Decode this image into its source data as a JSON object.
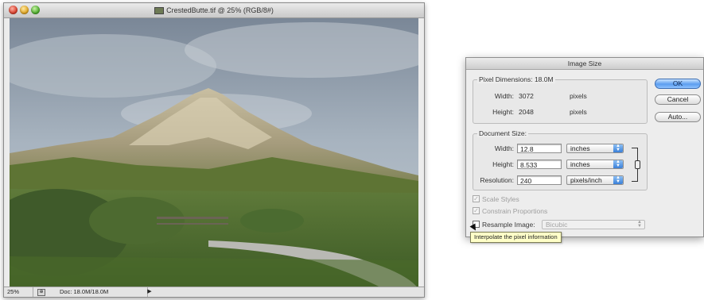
{
  "doc_window": {
    "title": "CrestedButte.tif @ 25% (RGB/8#)",
    "status_zoom": "25%",
    "status_doc": "Doc: 18.0M/18.0M"
  },
  "dialog": {
    "title": "Image Size",
    "pixel_dimensions": {
      "label": "Pixel Dimensions:",
      "size": "18.0M",
      "width_label": "Width:",
      "width_value": "3072",
      "width_unit": "pixels",
      "height_label": "Height:",
      "height_value": "2048",
      "height_unit": "pixels"
    },
    "document_size": {
      "label": "Document Size:",
      "width_label": "Width:",
      "width_value": "12.8",
      "width_unit": "inches",
      "height_label": "Height:",
      "height_value": "8.533",
      "height_unit": "inches",
      "resolution_label": "Resolution:",
      "resolution_value": "240",
      "resolution_unit": "pixels/inch"
    },
    "scale_styles_label": "Scale Styles",
    "constrain_label": "Constrain Proportions",
    "resample_label": "Resample Image:",
    "resample_method": "Bicubic",
    "buttons": {
      "ok": "OK",
      "cancel": "Cancel",
      "auto": "Auto..."
    }
  },
  "tooltip": "Interpolate the pixel information"
}
